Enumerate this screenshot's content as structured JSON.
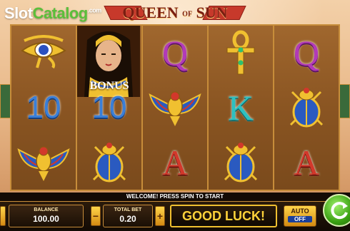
{
  "watermark": {
    "slot": "Slot",
    "catalog": "Catalog",
    "com": ".com"
  },
  "game": {
    "title_a": "QUEEN",
    "title_of": "OF",
    "title_b": "SUN"
  },
  "reels": {
    "r1": [
      "eye-of-horus",
      "10",
      "scarab-wings"
    ],
    "r2": [
      "queen-bonus",
      "10",
      "scarab"
    ],
    "r3": [
      "Q",
      "scarab-wings",
      "A"
    ],
    "r4": [
      "ankh",
      "K",
      "scarab"
    ],
    "r5": [
      "Q",
      "scarab",
      "A"
    ]
  },
  "symbols": {
    "ten": "10",
    "q": "Q",
    "k": "K",
    "a": "A",
    "bonus": "BONUS"
  },
  "status": {
    "message": "WELCOME! PRESS SPIN TO START"
  },
  "panel": {
    "balance_label": "BALANCE",
    "balance_value": "100.00",
    "bet_label": "TOTAL BET",
    "bet_value": "0.20",
    "minus": "−",
    "plus": "+",
    "message": "GOOD LUCK!",
    "auto_label": "AUTO",
    "auto_state": "OFF"
  },
  "colors": {
    "frame": "#c78d3a",
    "spin": "#3aa012",
    "accent": "#ffd23a"
  }
}
